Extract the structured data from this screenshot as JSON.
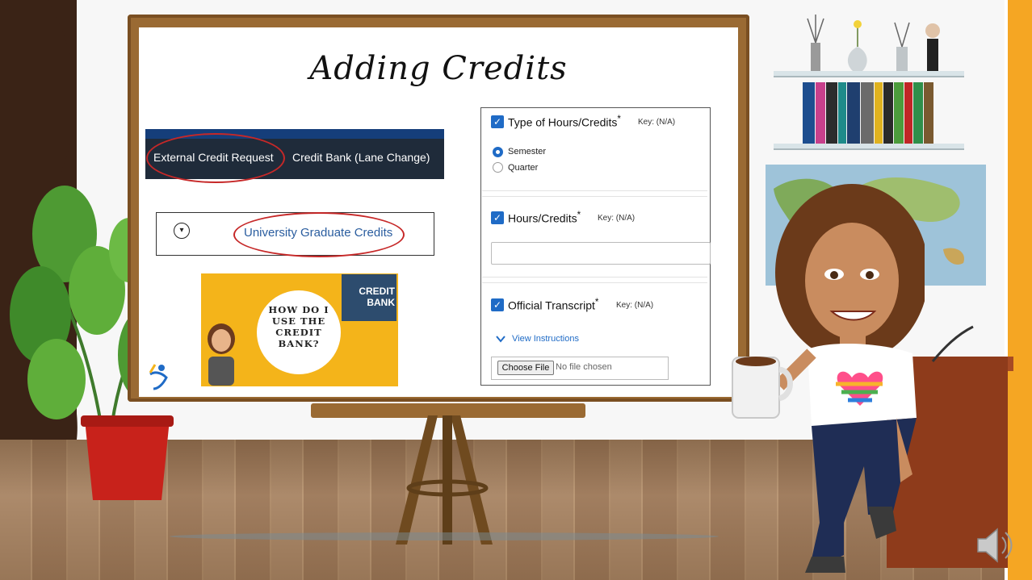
{
  "slide": {
    "title": "Adding Credits"
  },
  "tabs": {
    "external": "External Credit Request",
    "credit_bank": "Credit Bank (Lane Change)"
  },
  "accordion": {
    "expand_glyph": "▾",
    "label": "University Graduate Credits"
  },
  "video": {
    "headline": "HOW DO I USE THE CREDIT BANK?",
    "badge": "CREDIT BANK"
  },
  "form": {
    "type_field": {
      "label": "Type of Hours/Credits",
      "required": "*",
      "key": "Key: (N/A)"
    },
    "options": [
      {
        "label": "Semester",
        "selected": true
      },
      {
        "label": "Quarter",
        "selected": false
      }
    ],
    "hours_field": {
      "label": "Hours/Credits",
      "required": "*",
      "key": "Key: (N/A)",
      "value": ""
    },
    "transcript_field": {
      "label": "Official Transcript",
      "required": "*",
      "key": "Key: (N/A)"
    },
    "view_instructions": "View Instructions",
    "choose_file": "Choose File",
    "file_status": "No file chosen"
  },
  "icons": {
    "checkbox": "checkmark-icon",
    "chevron": "chevron-down-icon",
    "speaker": "speaker-icon"
  },
  "colors": {
    "accent_blue": "#1f6bc6",
    "annotation_red": "#c62828",
    "video_yellow": "#f4b41a",
    "side_orange": "#f5a623"
  }
}
